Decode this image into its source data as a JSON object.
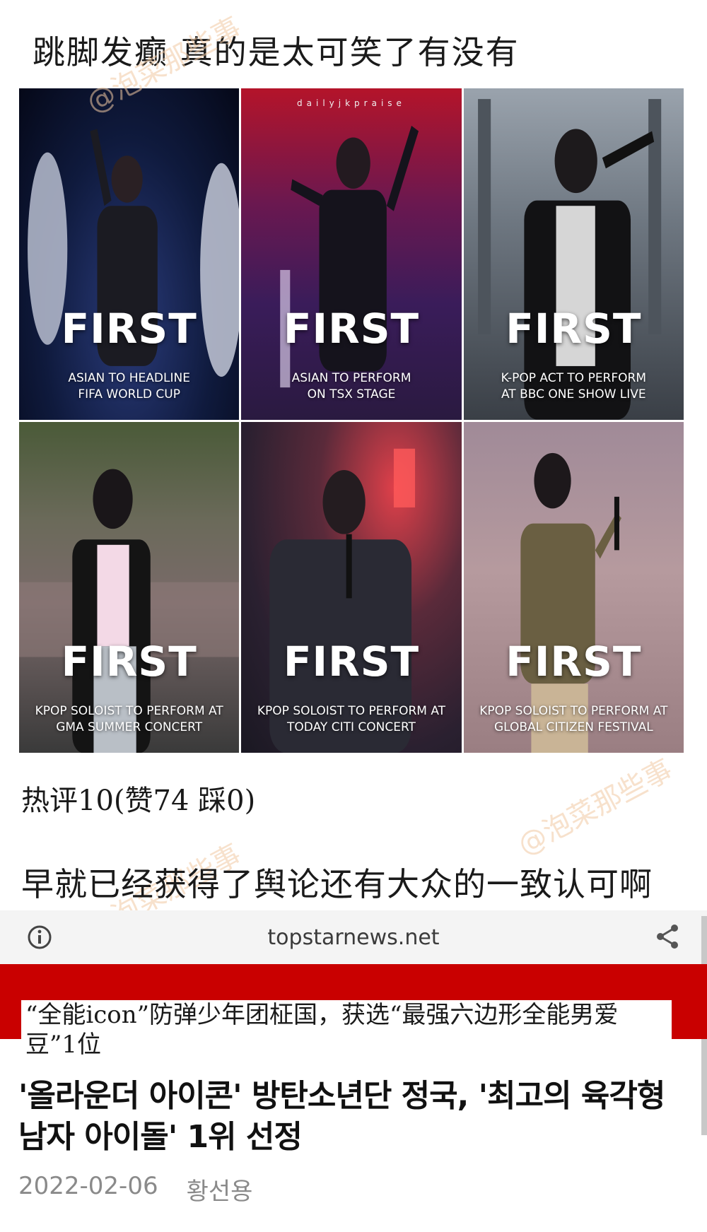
{
  "post": {
    "title": "跳脚发癫 真的是太可笑了有没有"
  },
  "watermark": "@泡菜那些事",
  "tiles": [
    {
      "headline": "FIRST",
      "caption_line1": "ASIAN TO HEADLINE",
      "caption_line2": "FIFA WORLD CUP",
      "credit": ""
    },
    {
      "headline": "FIRST",
      "caption_line1": "ASIAN TO PERFORM",
      "caption_line2": "ON TSX STAGE",
      "credit": "dailyjkpraise"
    },
    {
      "headline": "FIRST",
      "caption_line1": "K-POP ACT TO PERFORM",
      "caption_line2": "AT BBC ONE SHOW LIVE",
      "credit": ""
    },
    {
      "headline": "FIRST",
      "caption_line1": "KPOP SOLOIST TO PERFORM AT",
      "caption_line2": "GMA SUMMER CONCERT",
      "credit": ""
    },
    {
      "headline": "FIRST",
      "caption_line1": "KPOP SOLOIST TO PERFORM AT",
      "caption_line2": "TODAY CITI CONCERT",
      "credit": ""
    },
    {
      "headline": "FIRST",
      "caption_line1": "KPOP SOLOIST TO PERFORM AT",
      "caption_line2": "GLOBAL CITIZEN FESTIVAL",
      "credit": ""
    }
  ],
  "comment": {
    "meta": "热评10(赞74 踩0)",
    "body": "早就已经获得了舆论还有大众的一致认可啊"
  },
  "browser": {
    "url": "topstarnews.net",
    "info_icon": "info-icon",
    "share_icon": "share-icon"
  },
  "article": {
    "translation": "“全能icon”防弹少年团柾国，获选“最强六边形全能男爱豆”1位",
    "headline": "'올라운더 아이콘' 방탄소년단 정국, '최고의 육각형 남자 아이돌' 1위 선정",
    "date": "2022-02-06",
    "author": "황선용"
  },
  "colors": {
    "red_band": "#c90000",
    "watermark": "#f1c9a3"
  }
}
